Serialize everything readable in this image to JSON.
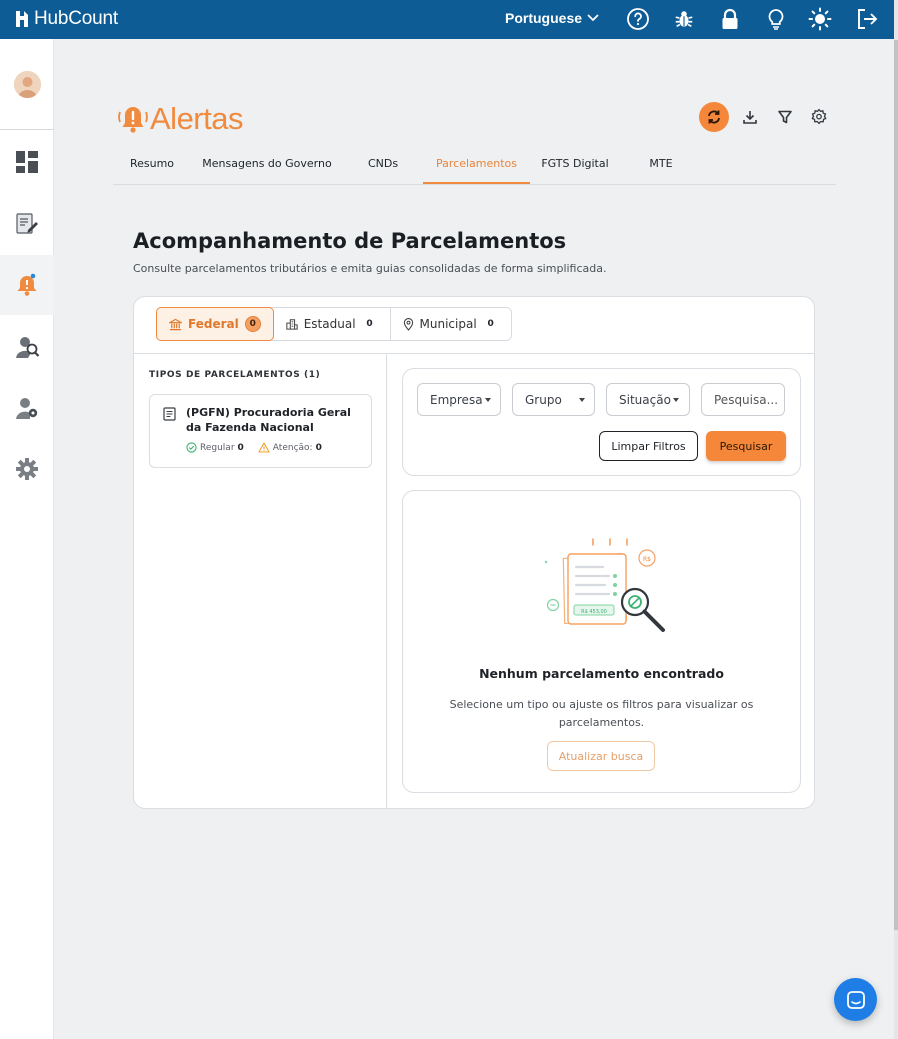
{
  "topbar": {
    "brand": "HubCount",
    "language": "Portuguese",
    "icons": [
      "help-icon",
      "bug-icon",
      "lock-icon",
      "lightbulb-icon",
      "sun-icon",
      "logout-icon"
    ]
  },
  "sidebar": {
    "items": [
      "dashboard-icon",
      "document-edit-icon",
      "bell-alert-icon",
      "user-search-icon",
      "user-settings-icon",
      "gear-icon"
    ],
    "active": "bell-alert-icon"
  },
  "header": {
    "logo_text": "Alertas",
    "actions": [
      "refresh-icon",
      "download-icon",
      "filter-icon",
      "settings-icon"
    ]
  },
  "tabs": [
    {
      "label": "Resumo"
    },
    {
      "label": "Mensagens do Governo"
    },
    {
      "label": "CNDs"
    },
    {
      "label": "Parcelamentos"
    },
    {
      "label": "FGTS Digital"
    },
    {
      "label": "MTE"
    }
  ],
  "active_tab": "Parcelamentos",
  "page": {
    "title": "Acompanhamento de Parcelamentos",
    "subtitle": "Consulte parcelamentos tributários e emita guias consolidadas de forma simplificada."
  },
  "segments": [
    {
      "label": "Federal",
      "count": "0"
    },
    {
      "label": "Estadual",
      "count": "0"
    },
    {
      "label": "Municipal",
      "count": "0"
    }
  ],
  "list": {
    "header": "TIPOS DE PARCELAMENTOS (1)",
    "items": [
      {
        "title": "(PGFN) Procuradoria Geral da Fazenda Nacional",
        "regular_label": "Regular",
        "regular_count": "0",
        "attention_label": "Atenção:",
        "attention_count": "0"
      }
    ]
  },
  "filters": {
    "empresa": "Empresa",
    "grupo": "Grupo",
    "situacao": "Situação",
    "search_placeholder": "Pesquisa...",
    "clear_label": "Limpar Filtros",
    "search_label": "Pesquisar"
  },
  "empty": {
    "illustration_amount": "R$ 453,00",
    "illustration_currency": "R$",
    "title": "Nenhum parcelamento encontrado",
    "description": "Selecione um tipo ou ajuste os filtros para visualizar os parcelamentos.",
    "refresh_label": "Atualizar busca"
  },
  "colors": {
    "topbar": "#0d5c96",
    "accent": "#f08a3e",
    "success": "#3bb273",
    "warning": "#f0a030",
    "chat": "#1f7ee6"
  }
}
